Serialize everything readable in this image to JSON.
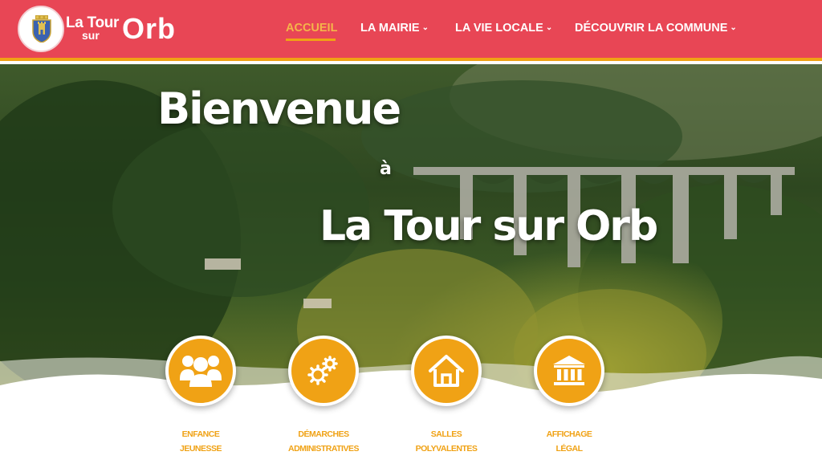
{
  "brand": {
    "line1": "La Tour",
    "line2": "sur",
    "big": "Orb"
  },
  "nav": {
    "items": [
      {
        "label": "ACCUEIL",
        "has_dropdown": false,
        "active": true
      },
      {
        "label": "LA MAIRIE",
        "has_dropdown": true,
        "active": false
      },
      {
        "label": "LA VIE LOCALE",
        "has_dropdown": true,
        "active": false
      },
      {
        "label": "DÉCOUVRIR LA COMMUNE",
        "has_dropdown": true,
        "active": false
      }
    ]
  },
  "hero": {
    "line1": "Bienvenue",
    "line2": "à",
    "line3": "La Tour sur Orb"
  },
  "quick_links": [
    {
      "icon": "people-icon",
      "line1": "ENFANCE",
      "line2": "JEUNESSE"
    },
    {
      "icon": "gears-icon",
      "line1": "DÉMARCHES",
      "line2": "ADMINISTRATIVES"
    },
    {
      "icon": "house-icon",
      "line1": "SALLES",
      "line2": "POLYVALENTES"
    },
    {
      "icon": "bank-icon",
      "line1": "AFFICHAGE",
      "line2": "LÉGAL"
    }
  ],
  "colors": {
    "header": "#e84655",
    "accent": "#f0a215",
    "active_nav": "#f4b54a"
  }
}
